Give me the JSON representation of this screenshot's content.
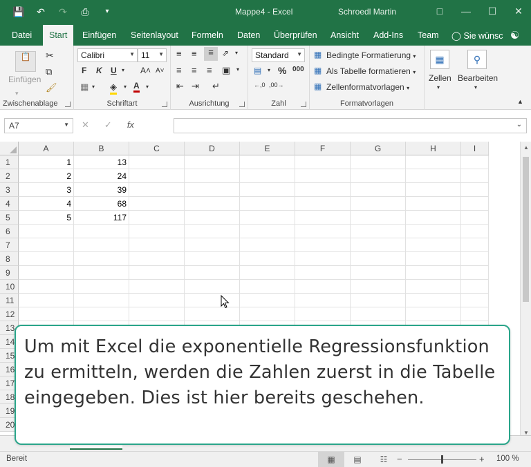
{
  "titlebar": {
    "title": "Mappe4  -  Excel",
    "user": "Schroedl Martin",
    "icons": [
      "save-icon",
      "undo-icon",
      "redo-icon",
      "print-preview-icon",
      "customize-qat-icon",
      "ribbon-display-icon",
      "minimize-icon",
      "maximize-icon",
      "close-icon"
    ]
  },
  "tabs": {
    "items": [
      "Datei",
      "Start",
      "Einfügen",
      "Seitenlayout",
      "Formeln",
      "Daten",
      "Überprüfen",
      "Ansicht",
      "Add-Ins",
      "Team"
    ],
    "active": "Start",
    "search": "Sie wünsc"
  },
  "ribbon": {
    "clipboard": {
      "paste_label": "Einfügen",
      "group_label": "Zwischenablage"
    },
    "font": {
      "font_name": "Calibri",
      "font_size": "11",
      "bold": "F",
      "italic": "K",
      "underline": "U",
      "group_label": "Schriftart"
    },
    "alignment": {
      "group_label": "Ausrichtung"
    },
    "number": {
      "format": "Standard",
      "percent": "%",
      "thousands": "000",
      "group_label": "Zahl"
    },
    "styles": {
      "conditional": "Bedingte Formatierung",
      "as_table": "Als Tabelle formatieren",
      "cell_styles": "Zellenformatvorlagen",
      "group_label": "Formatvorlagen"
    },
    "cells": {
      "label": "Zellen"
    },
    "editing": {
      "label": "Bearbeiten"
    }
  },
  "formulabar": {
    "namebox": "A7",
    "fx": "fx",
    "content": ""
  },
  "sheet": {
    "columns": [
      "A",
      "B",
      "C",
      "D",
      "E",
      "F",
      "G",
      "H",
      "I"
    ],
    "rows": [
      "1",
      "2",
      "3",
      "4",
      "5",
      "6",
      "7",
      "8",
      "9",
      "10",
      "11",
      "12",
      "13",
      "14",
      "15",
      "16",
      "17",
      "18",
      "19",
      "20"
    ],
    "data": [
      [
        "1",
        "13"
      ],
      [
        "2",
        "24"
      ],
      [
        "3",
        "39"
      ],
      [
        "4",
        "68"
      ],
      [
        "5",
        "117"
      ]
    ]
  },
  "statusbar": {
    "ready": "Bereit",
    "zoom": "100 %"
  },
  "caption": {
    "text": "Um mit Excel die exponentielle Regressionsfunktion zu ermitteln, werden die Zahlen zuerst in die Tabelle eingegeben. Dies ist hier bereits geschehen."
  },
  "colors": {
    "excel_green": "#217346",
    "caption_border": "#2aa58a"
  }
}
